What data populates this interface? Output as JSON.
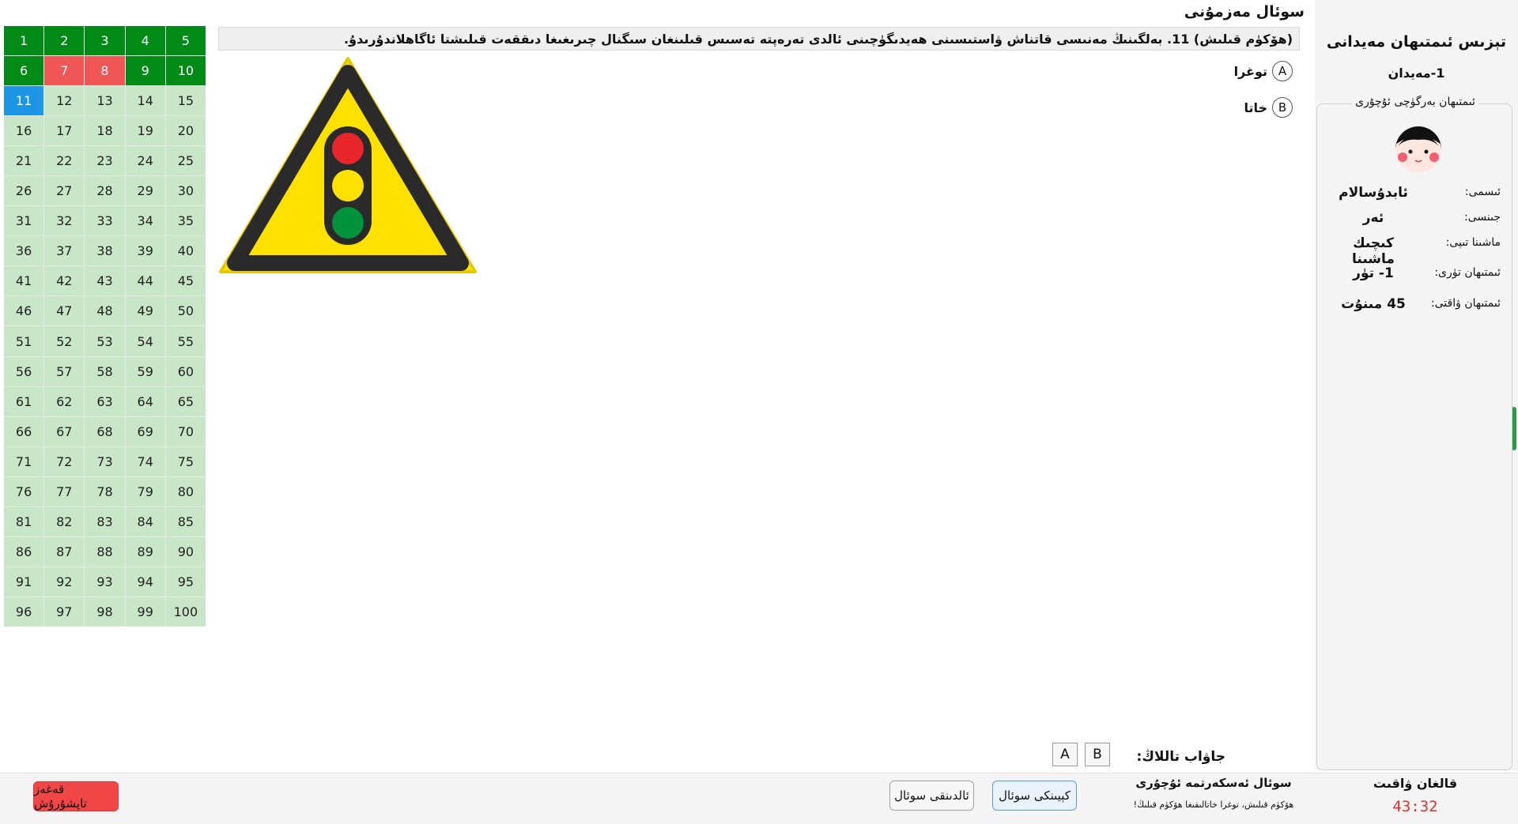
{
  "window": {
    "minimize_glyph": "–",
    "close_glyph": "✕"
  },
  "content_title": "سوئال مەزمۇنى",
  "question_text": "(ھۆكۈم قىلىش) 11. بەلگىنىڭ مەنىسى قاتناش ۋاستىسىنى ھەيدىگۈچىنى ئالدى تەرەپتە تەسىس قىلىنغان سىگنال چىرىغىغا دىققەت قىلىشتا ئاگاھلاندۇرىدۇ.",
  "options": [
    {
      "letter": "A",
      "text": "توغرا"
    },
    {
      "letter": "B",
      "text": "خاتا"
    }
  ],
  "grid": {
    "numbers": [
      1,
      2,
      3,
      4,
      5,
      6,
      7,
      8,
      9,
      10,
      11,
      12,
      13,
      14,
      15,
      16,
      17,
      18,
      19,
      20,
      21,
      22,
      23,
      24,
      25,
      26,
      27,
      28,
      29,
      30,
      31,
      32,
      33,
      34,
      35,
      36,
      37,
      38,
      39,
      40,
      41,
      42,
      43,
      44,
      45,
      46,
      47,
      48,
      49,
      50,
      51,
      52,
      53,
      54,
      55,
      56,
      57,
      58,
      59,
      60,
      61,
      62,
      63,
      64,
      65,
      66,
      67,
      68,
      69,
      70,
      71,
      72,
      73,
      74,
      75,
      76,
      77,
      78,
      79,
      80,
      81,
      82,
      83,
      84,
      85,
      86,
      87,
      88,
      89,
      90,
      91,
      92,
      93,
      94,
      95,
      96,
      97,
      98,
      99,
      100
    ],
    "correct": [
      1,
      2,
      3,
      4,
      5,
      6,
      9,
      10
    ],
    "wrong": [
      7,
      8
    ],
    "current": 11
  },
  "sign": {
    "icon": "traffic-light-warning-sign-icon",
    "triangle_color": "#ffe100",
    "border_color": "#2a2a2a",
    "lights": [
      "#e8262b",
      "#ffe100",
      "#00933c"
    ]
  },
  "right_panel": {
    "title": "تېزىس ئىمتىھان مەيدانى",
    "subtitle": "1-مەيدان",
    "participant_legend": "ئىمتىھان بەرگۈچى ئۇچۇرى",
    "avatar_icon": "avatar-face-icon",
    "fields": [
      {
        "label": "ئىسمى:",
        "value": "ئابدۇسالام"
      },
      {
        "label": "جىنسى:",
        "value": "ئەر"
      },
      {
        "label": "ماشىنا تىپى:",
        "value": "كىچىك ماشىنا"
      },
      {
        "label": "ئىمتىھان تۈرى:",
        "value": "1- تۈر"
      },
      {
        "label": "ئىمتىھان ۋاقتى:",
        "value": "45 مىنۇت"
      }
    ]
  },
  "answer_select": {
    "label": "جاۋاب تاللاڭ:",
    "options": [
      "A",
      "B"
    ]
  },
  "bottom": {
    "time_left_label": "قالغان ۋاقىت",
    "time_left_value": "43:32",
    "info_title": "سوئال ئەسكەرتمە ئۇچۇرى",
    "info_text": "ھۆكۈم قىلىش، توغرا خاتالىقىغا ھۆكۈم قىلىڭ!",
    "next_label": "كېيىنكى سوئال",
    "prev_label": "ئالدىنقى سوئال",
    "submit_label": "قەغەز تاپشۇرۇش"
  },
  "colors": {
    "correct": "#008a16",
    "wrong": "#f05656",
    "current": "#1e96e6",
    "pending": "#c9e6c9",
    "timer": "#e03131"
  }
}
